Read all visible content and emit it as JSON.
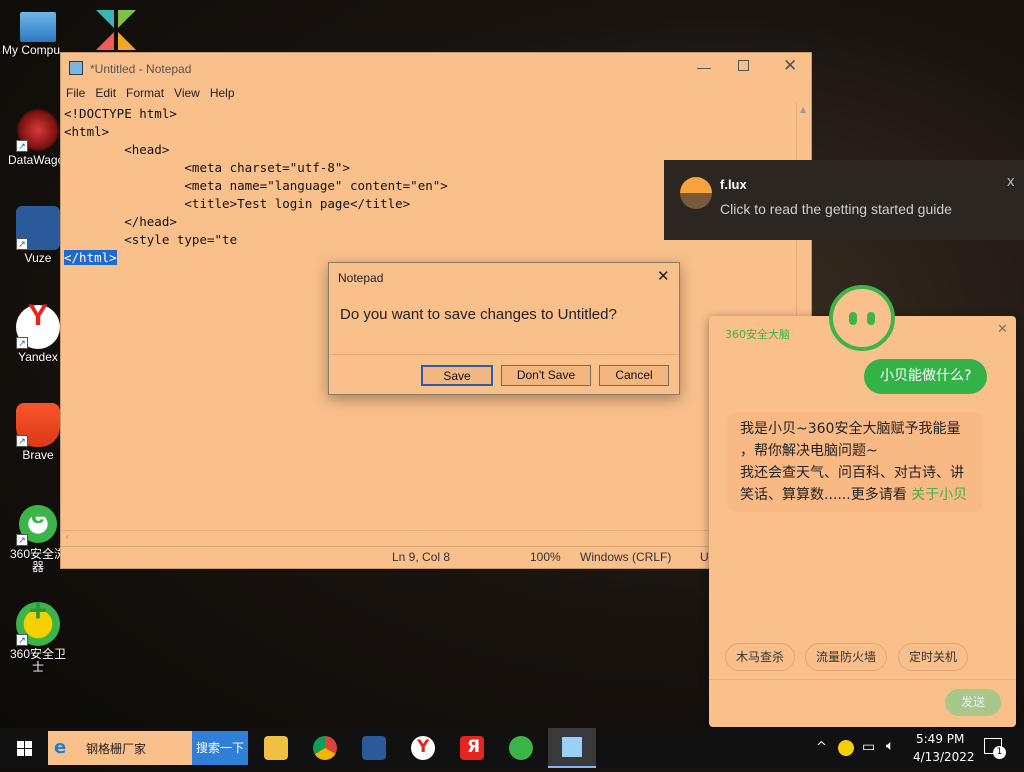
{
  "desktop": {
    "icons": [
      {
        "label": "My Compu"
      },
      {
        "label": "DataWagon"
      },
      {
        "label": "Vuze"
      },
      {
        "label": "Yandex"
      },
      {
        "label": "Brave"
      },
      {
        "label": "360安全浏\n器"
      },
      {
        "label": "360安全卫士"
      }
    ]
  },
  "notepad": {
    "title": "*Untitled - Notepad",
    "menu": [
      "File",
      "Edit",
      "Format",
      "View",
      "Help"
    ],
    "content_lines": [
      "<!DOCTYPE html>",
      "<html>",
      "        <head>",
      "                <meta charset=\"utf-8\">",
      "                <meta name=\"language\" content=\"en\">",
      "                <title>Test login page</title>",
      "        </head>",
      "        <style type=\"te"
    ],
    "selected_line": "</html>",
    "status": {
      "position": "Ln 9, Col 8",
      "zoom": "100%",
      "line_ending": "Windows (CRLF)",
      "encoding": "UT"
    }
  },
  "dialog": {
    "title": "Notepad",
    "message": "Do you want to save changes to Untitled?",
    "save": "Save",
    "dont_save": "Don't Save",
    "cancel": "Cancel"
  },
  "flux": {
    "title": "f.lux",
    "message": "Click to read the getting started guide",
    "close": "x"
  },
  "assistant": {
    "brand": "360安全大脑",
    "user_bubble": "小贝能做什么?",
    "reply_lines": [
      "我是小贝~360安全大脑赋予我能量",
      "，帮你解决电脑问题~",
      "我还会查天气、问百科、对古诗、讲",
      "笑话、算算数......更多请看 "
    ],
    "reply_link": "关于小贝",
    "chips": [
      "木马查杀",
      "流量防火墙",
      "定时关机"
    ],
    "send": "发送"
  },
  "taskbar": {
    "search_text": "钢格栅厂家",
    "search_button": "搜索一下",
    "time": "5:49 PM",
    "date": "4/13/2022",
    "notification_count": "1"
  },
  "colors": {
    "window_bg": "#fac08c",
    "selection": "#1e6ad0",
    "assistant_green": "#2fae3d",
    "taskbar": "#111111"
  }
}
